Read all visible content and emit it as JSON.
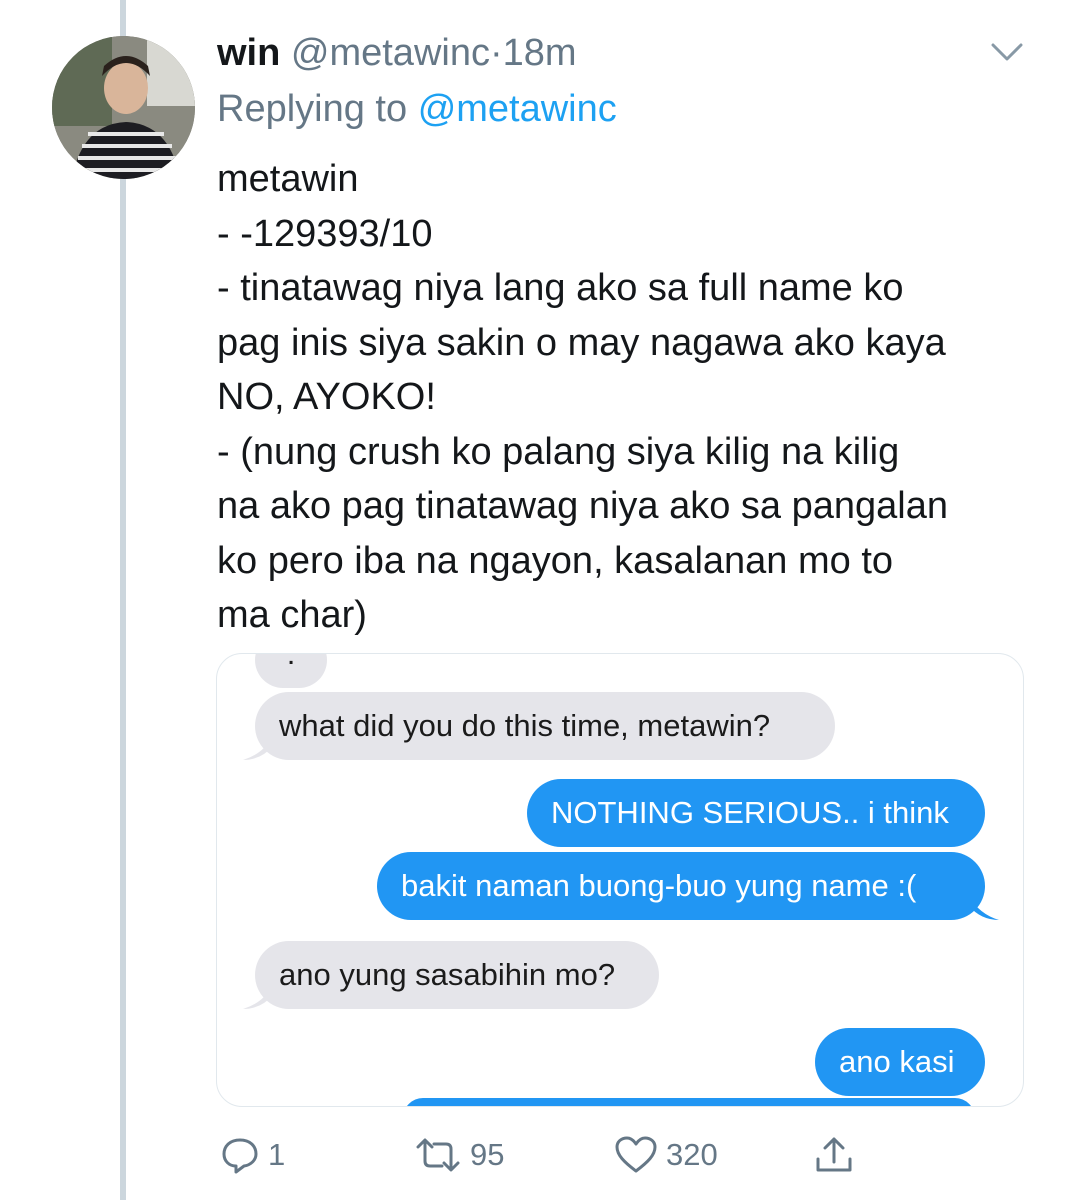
{
  "tweet": {
    "author_name": "win",
    "handle": "@metawinc",
    "separator": "·",
    "time": "18m",
    "replying_prefix": "Replying to",
    "replying_to": "@metawinc",
    "body_lines": [
      "metawin",
      "- -129393/10",
      "- tinatawag niya lang ako sa full name ko",
      "pag inis siya sakin o may nagawa ako kaya",
      "NO, AYOKO!",
      "- (nung crush ko palang siya kilig na kilig",
      "na ako pag tinatawag niya ako sa pangalan",
      "ko pero iba na ngayon, kasalanan mo to",
      "ma char)"
    ]
  },
  "media": {
    "messages": [
      {
        "side": "received",
        "text": ":"
      },
      {
        "side": "received",
        "text": "what did you do this time, metawin?"
      },
      {
        "side": "sent",
        "text": "NOTHING SERIOUS.. i think"
      },
      {
        "side": "sent",
        "text": "bakit naman buong-buo yung name :("
      },
      {
        "side": "received",
        "text": "ano yung sasabihin mo?"
      },
      {
        "side": "sent",
        "text": "ano kasi"
      }
    ]
  },
  "actions": {
    "reply_count": "1",
    "retweet_count": "95",
    "like_count": "320"
  },
  "colors": {
    "link": "#1da1f2",
    "muted": "#657786",
    "sent_bubble": "#2196f3",
    "received_bubble": "#e5e5ea",
    "thread_line": "#ccd6dd"
  },
  "icons": [
    "chevron-down-icon",
    "reply-icon",
    "retweet-icon",
    "like-icon",
    "share-icon"
  ]
}
